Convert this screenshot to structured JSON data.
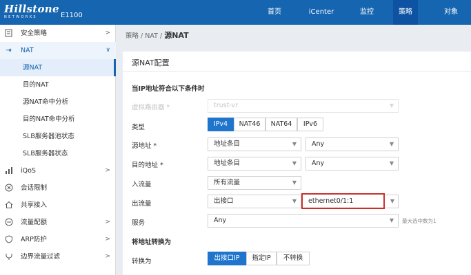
{
  "app": {
    "logo_main": "Hillstone",
    "logo_sub": "NETWORKS",
    "model": "E1100"
  },
  "nav": {
    "items": [
      {
        "label": "首页"
      },
      {
        "label": "iCenter"
      },
      {
        "label": "监控"
      },
      {
        "label": "策略"
      },
      {
        "label": "对象"
      }
    ],
    "active": "策略"
  },
  "sidebar": {
    "items": [
      {
        "label": "安全策略"
      },
      {
        "label": "NAT"
      },
      {
        "label": "源NAT"
      },
      {
        "label": "目的NAT"
      },
      {
        "label": "源NAT命中分析"
      },
      {
        "label": "目的NAT命中分析"
      },
      {
        "label": "SLB服务器池状态"
      },
      {
        "label": "SLB服务器状态"
      },
      {
        "label": "iQoS"
      },
      {
        "label": "会话限制"
      },
      {
        "label": "共享接入"
      },
      {
        "label": "流量配额"
      },
      {
        "label": "ARP防护"
      },
      {
        "label": "边界流量过滤"
      }
    ]
  },
  "breadcrumb": {
    "parts": [
      "策略",
      "NAT"
    ],
    "separator": "/",
    "current": "源NAT"
  },
  "panel": {
    "title": "源NAT配置",
    "section1": "当IP地址符合以下条件时",
    "section2": "将地址转换为",
    "fields": {
      "virtual_router": {
        "label": "虚拟路由器 *",
        "value": "trust-vr"
      },
      "type": {
        "label": "类型",
        "options": [
          "IPv4",
          "NAT46",
          "NAT64",
          "IPv6"
        ],
        "selected": "IPv4"
      },
      "src_addr": {
        "label": "源地址 *",
        "kind": "地址条目",
        "value": "Any"
      },
      "dst_addr": {
        "label": "目的地址 *",
        "kind": "地址条目",
        "value": "Any"
      },
      "ingress": {
        "label": "入流量",
        "value": "所有流量"
      },
      "egress": {
        "label": "出流量",
        "kind": "出接口",
        "value": "ethernet0/1:1"
      },
      "service": {
        "label": "服务",
        "value": "Any",
        "hint": "最大选中数为1"
      },
      "translate": {
        "label": "转换为",
        "options": [
          "出接口IP",
          "指定IP",
          "不转换"
        ],
        "selected": "出接口IP"
      }
    }
  },
  "colors": {
    "brand": "#1565b0",
    "active_button": "#1f75cc",
    "highlight_border": "#c9302c"
  }
}
